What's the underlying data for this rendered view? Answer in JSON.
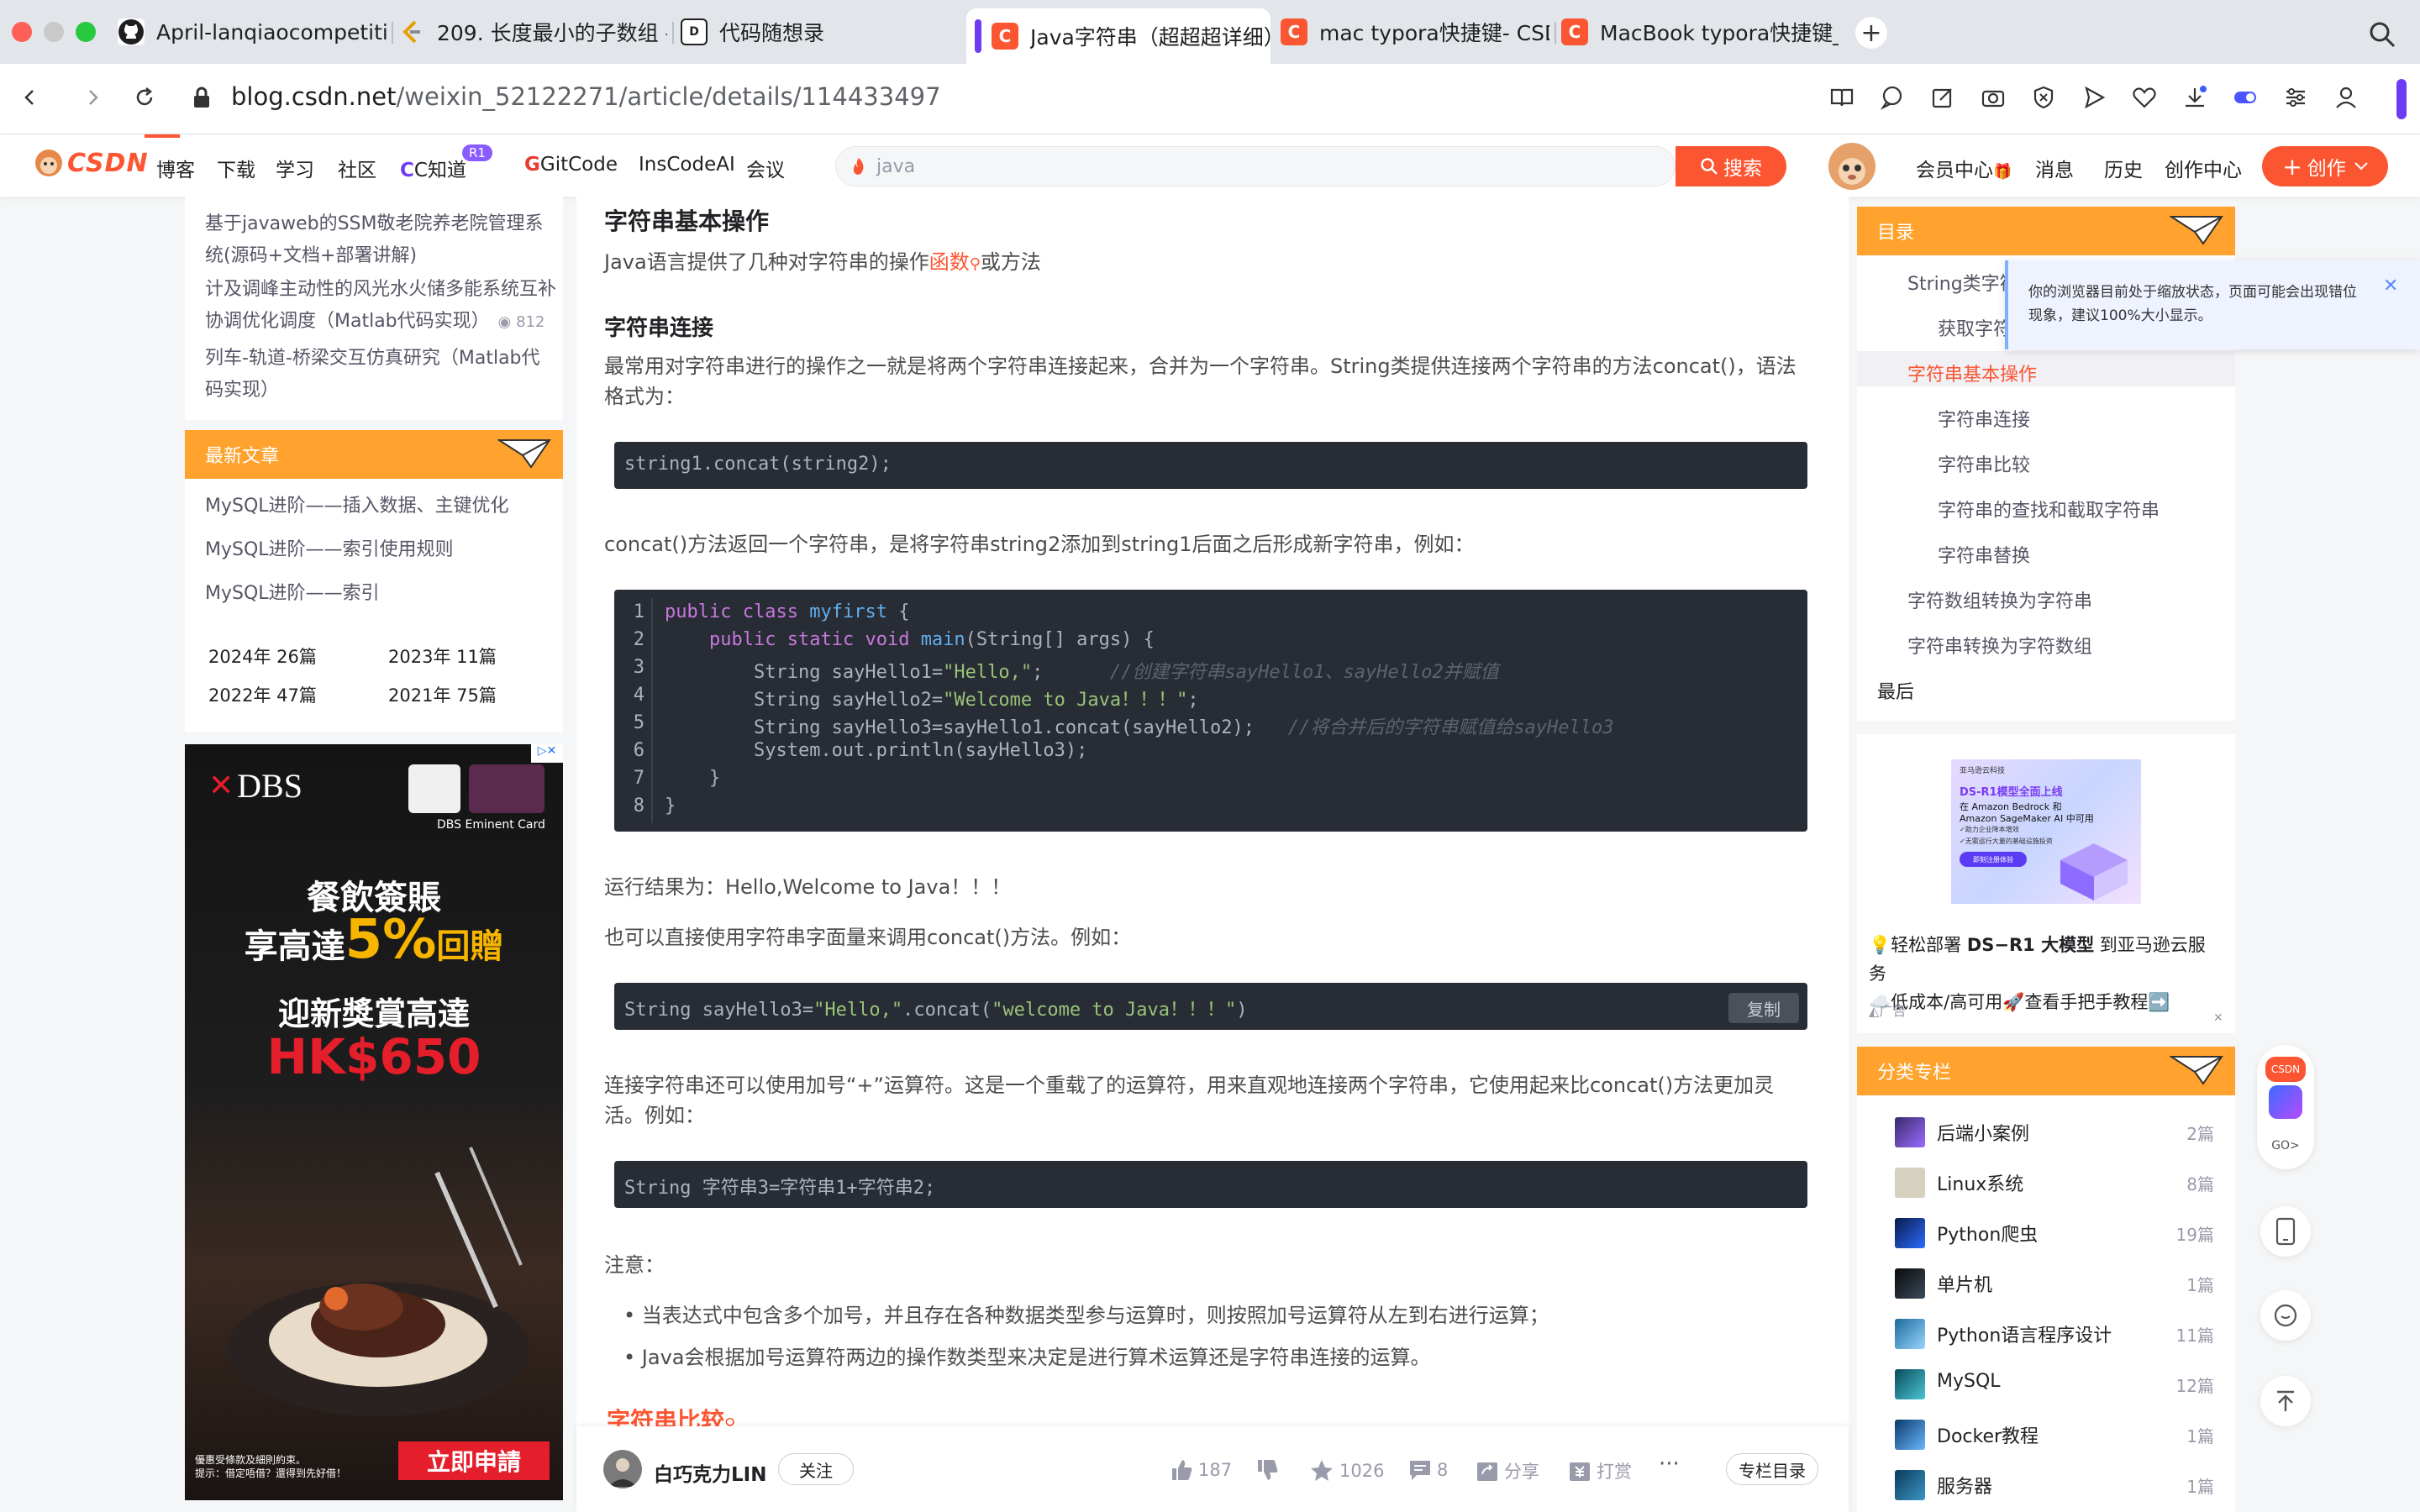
{
  "browser": {
    "tabs": [
      {
        "title": "April-lanqiaocompetition",
        "favicon": "github-icon"
      },
      {
        "title": "209. 长度最小的子数组 -",
        "favicon": "leetcode-icon"
      },
      {
        "title": "代码随想录",
        "favicon": "daimasuixianglu-icon"
      },
      {
        "title": "Java字符串（超超超详细）",
        "favicon": "csdn-icon",
        "active": true
      },
      {
        "title": "mac typora快捷键- CSDN",
        "favicon": "csdn-icon"
      },
      {
        "title": "MacBook typora快捷键_t",
        "favicon": "csdn-icon"
      }
    ],
    "url_domain": "blog.csdn.net",
    "url_path": "/weixin_52122271/article/details/114433497"
  },
  "csdn_nav": {
    "logo": "CSDN",
    "items": [
      "博客",
      "下载",
      "学习",
      "社区",
      "C知道",
      "GitCode",
      "InsCodeAI",
      "会议"
    ],
    "badge_r1": "R1",
    "search_value": "java",
    "search_button": "搜索",
    "right_items": [
      "会员中心",
      "消息",
      "历史",
      "创作中心"
    ],
    "create_button": "创作"
  },
  "left": {
    "recommend": [
      "基于javaweb的SSM敬老院养老院管理系统(源码+文档+部署讲解)",
      "计及调峰主动性的风光水火储多能系统互补协调优化调度（Matlab代码实现）",
      "列车-轨道-桥梁交互仿真研究（Matlab代码实现）"
    ],
    "recommend_views": "812",
    "latest_title": "最新文章",
    "latest": [
      "MySQL进阶——插入数据、主键优化",
      "MySQL进阶——索引使用规则",
      "MySQL进阶——索引"
    ],
    "archive": [
      "2024年 26篇",
      "2023年 11篇",
      "2022年 47篇",
      "2021年 75篇"
    ],
    "ad": {
      "brand": "DBS",
      "card_label": "DBS Eminent Card",
      "line1": "餐飲簽賬",
      "line2_a": "享高達",
      "line2_b": "5%",
      "line2_c": "回贈",
      "line3": "迎新獎賞高達",
      "line4": "HK$650",
      "cta": "立即申請",
      "disclaimer1": "優惠受條款及細則約束。",
      "disclaimer2": "提示：借定唔借？還得到先好借！"
    }
  },
  "article": {
    "section_title": "字符串基本操作",
    "intro_a": "Java语言提供了几种对字符串的操作",
    "intro_link": "函数",
    "intro_b": "或方法",
    "concat_title": "字符串连接",
    "concat_desc": "最常用对字符串进行的操作之一就是将两个字符串连接起来，合并为一个字符串。String类提供连接两个字符串的方法concat()，语法格式为：",
    "code1": "string1.concat(string2);",
    "concat_return": "concat()方法返回一个字符串，是将字符串string2添加到string1后面之后形成新字符串，例如：",
    "code2_lines": [
      "1",
      "2",
      "3",
      "4",
      "5",
      "6",
      "7",
      "8"
    ],
    "run_result": "运行结果为：Hello,Welcome to Java！！！",
    "direct_call": "也可以直接使用字符串字面量来调用concat()方法。例如：",
    "code3_a": "String sayHello3=",
    "code3_b": "\"Hello,\"",
    "code3_c": ".concat(",
    "code3_d": "\"welcome to Java！！！\"",
    "code3_e": ")",
    "copy_button": "复制",
    "plus_desc": "连接字符串还可以使用加号“+”运算符。这是一个重载了的运算符，用来直观地连接两个字符串，它使用起来比concat()方法更加灵活。例如：",
    "code4": "String 字符串3=字符串1+字符串2;",
    "note": "注意：",
    "bullets": [
      "当表达式中包含多个加号，并且存在各种数据类型参与运算时，则按照加号运算符从左到右进行运算；",
      "Java会根据加号运算符两边的操作数类型来决定是进行算术运算还是字符串连接的运算。"
    ],
    "next_section": "字符串比较"
  },
  "code": {
    "l1": [
      "public",
      "class",
      "myfirst",
      "{"
    ],
    "l2": [
      "public",
      "static",
      "void",
      "main",
      "(String[] args) {"
    ],
    "l3": [
      "String sayHello1=",
      "\"Hello,\"",
      ";",
      "//创建字符串sayHello1、sayHello2并赋值"
    ],
    "l4": [
      "String sayHello2=",
      "\"Welcome to Java！！！\"",
      ";"
    ],
    "l5": [
      "String sayHello3=sayHello1.concat(sayHello2);",
      "//将合并后的字符串赋值给sayHello3"
    ],
    "l6": [
      "System.out.println(sayHello3);"
    ],
    "l7": [
      "}"
    ],
    "l8": [
      "}"
    ]
  },
  "bottom": {
    "author": "白巧克力LIN",
    "follow": "关注",
    "likes": "187",
    "favorites": "1026",
    "comments": "8",
    "share": "分享",
    "reward": "打赏",
    "more": "···",
    "catalog": "专栏目录"
  },
  "toc": {
    "title": "目录",
    "items": [
      {
        "label": "String类字符串",
        "level": 1
      },
      {
        "label": "获取字符串",
        "level": 2
      },
      {
        "label": "字符串基本操作",
        "level": 1,
        "active": true
      },
      {
        "label": "字符串连接",
        "level": 2
      },
      {
        "label": "字符串比较",
        "level": 2
      },
      {
        "label": "字符串的查找和截取字符串",
        "level": 2
      },
      {
        "label": "字符串替换",
        "level": 2
      },
      {
        "label": "字符数组转换为字符串",
        "level": 1
      },
      {
        "label": "字符串转换为字符数组",
        "level": 1
      },
      {
        "label": "最后",
        "level": 0
      }
    ]
  },
  "zoom_notice": "你的浏览器目前处于缩放状态，页面可能会出现错位现象，建议100%大小显示。",
  "right_ad": {
    "img_brand": "亚马逊云科技",
    "img_line1": "DS-R1模型全面上线",
    "img_line2": "在 Amazon Bedrock 和",
    "img_line3": "Amazon SageMaker AI 中可用",
    "img_line4": "✓助力企业降本增效",
    "img_line5": "✓无需运行大量的基础设施投资",
    "img_btn": "即刻注册体验",
    "text_a": "💡轻松部署 ",
    "text_b": "DS−R1 大模型",
    "text_c": " 到亚马逊云服务",
    "text_d": "☁️低成本/高可用🚀查看手把手教程➡️",
    "ad_label": "广告"
  },
  "columns": {
    "title": "分类专栏",
    "items": [
      {
        "name": "后端小案例",
        "count": "2篇"
      },
      {
        "name": "Linux系统",
        "count": "8篇"
      },
      {
        "name": "Python爬虫",
        "count": "19篇"
      },
      {
        "name": "单片机",
        "count": "1篇"
      },
      {
        "name": "Python语言程序设计",
        "count": "11篇"
      },
      {
        "name": "MySQL",
        "count": "12篇"
      },
      {
        "name": "Docker教程",
        "count": "1篇"
      },
      {
        "name": "服务器",
        "count": "1篇"
      }
    ]
  },
  "float": {
    "go": "GO>",
    "csdn": "CSDN"
  },
  "colors": {
    "accent": "#fc5531",
    "panel_orange": "#ffa32e",
    "code_bg": "#282c34",
    "link_red": "#fc5531"
  }
}
